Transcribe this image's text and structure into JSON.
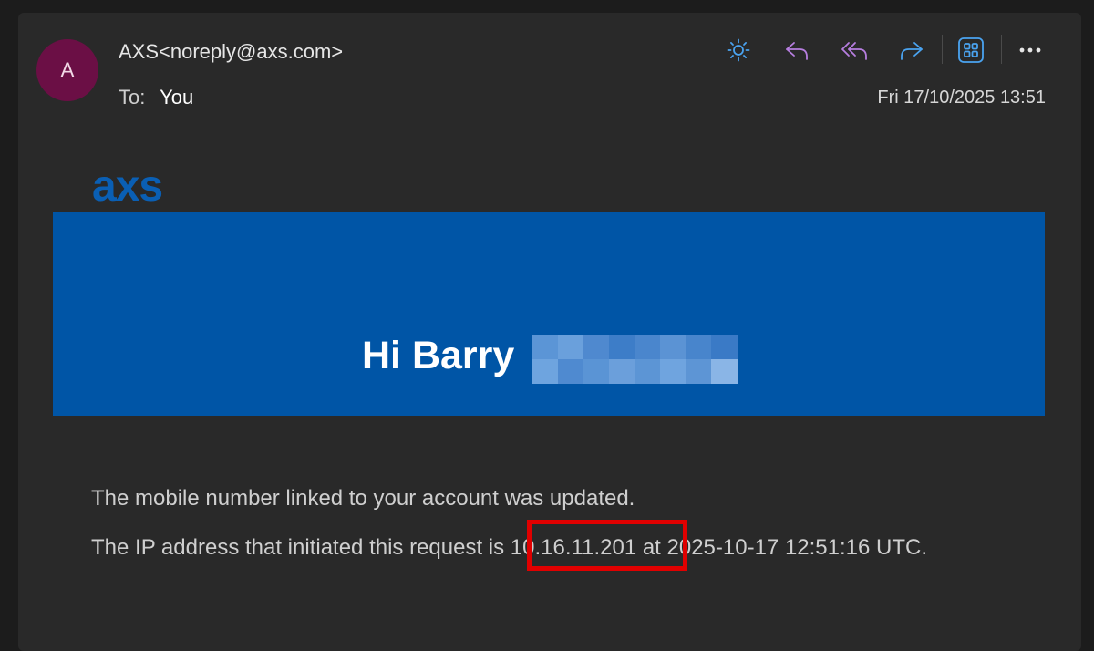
{
  "header": {
    "avatar_initial": "A",
    "sender": "AXS<noreply@axs.com>",
    "to_label": "To:",
    "to_value": "You",
    "date": "Fri 17/10/2025 13:51"
  },
  "toolbar": {
    "icons": [
      "sun-icon",
      "reply-icon",
      "reply-all-icon",
      "forward-icon",
      "apps-icon",
      "more-icon"
    ]
  },
  "email": {
    "logo_text": "axs",
    "greeting": "Hi Barry",
    "line1": "The mobile number linked to your account was updated.",
    "line2": "The IP address that initiated this request is 10.16.11.201 at 2025-10-17 12:51:16 UTC."
  },
  "colors": {
    "banner": "#0055a6",
    "logo": "#0a5fb4",
    "avatar": "#6b0f45",
    "highlight_box": "#e00000",
    "icon_blue": "#4aa3f0",
    "icon_purple": "#b77ee0"
  }
}
